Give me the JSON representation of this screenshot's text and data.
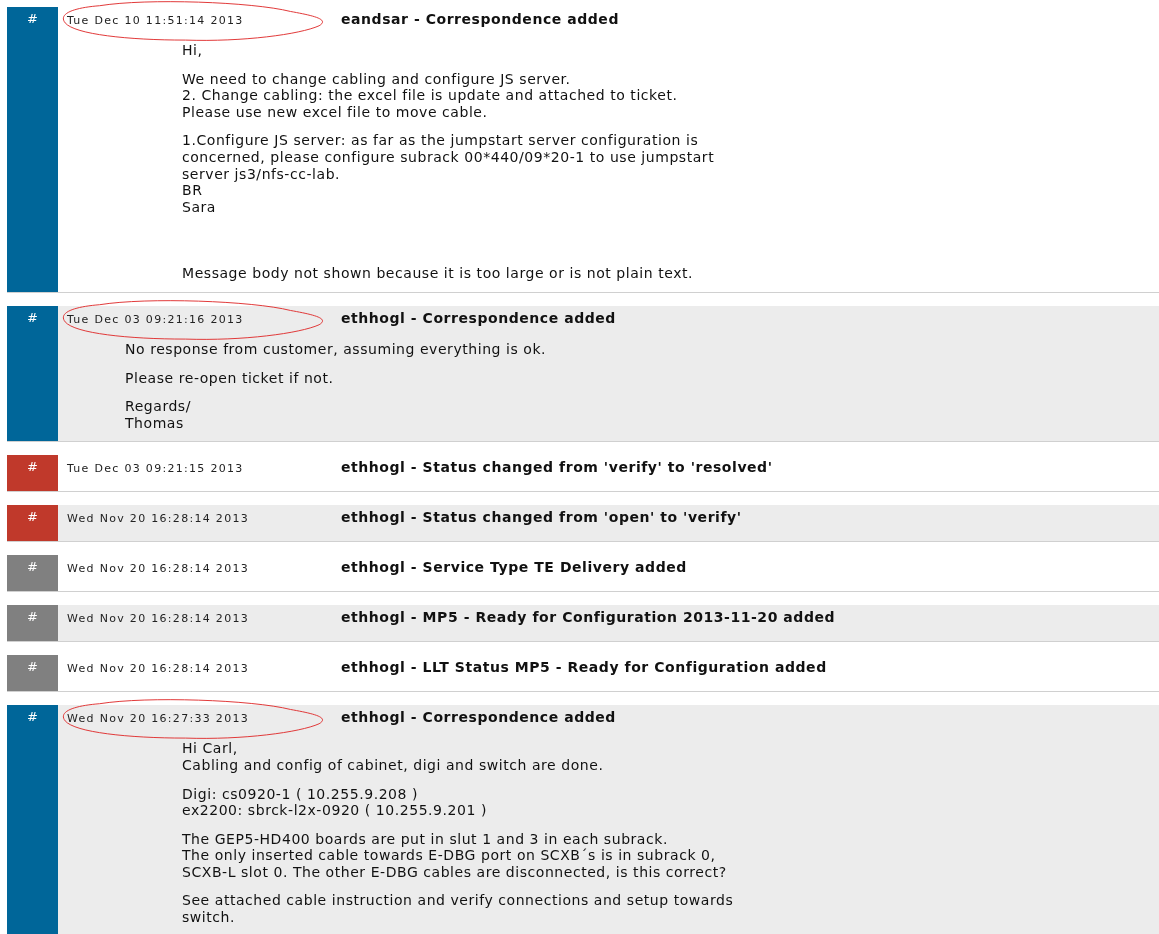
{
  "entries": [
    {
      "marker": "#",
      "kind": "correspondence",
      "shaded": false,
      "circled": true,
      "wide_indent": true,
      "date": "Tue Dec 10 11:51:14 2013",
      "title": "eandsar - Correspondence added",
      "paragraphs": [
        "Hi,",
        "We need to change cabling and configure JS server.\n2. Change cabling: the excel file is update and attached to ticket.\nPlease use new excel file to move cable.",
        "1.Configure JS server: as far as the jumpstart server configuration is\nconcerned, please configure subrack 00*440/09*20-1 to use jumpstart\nserver js3/nfs-cc-lab.\nBR\nSara"
      ],
      "note": "Message body not shown because it is too large or is not plain text."
    },
    {
      "marker": "#",
      "kind": "correspondence",
      "shaded": true,
      "circled": true,
      "wide_indent": false,
      "date": "Tue Dec 03 09:21:16 2013",
      "title": "ethhogl - Correspondence added",
      "paragraphs": [
        "No response from customer, assuming everything is ok.",
        "Please re-open ticket if not.",
        "Regards/\nThomas"
      ]
    },
    {
      "marker": "#",
      "kind": "status",
      "shaded": false,
      "circled": false,
      "date": "Tue Dec 03 09:21:15 2013",
      "title": "ethhogl - Status changed from 'verify' to 'resolved'"
    },
    {
      "marker": "#",
      "kind": "status",
      "shaded": true,
      "circled": false,
      "date": "Wed Nov 20 16:28:14 2013",
      "title": "ethhogl - Status changed from 'open' to 'verify'"
    },
    {
      "marker": "#",
      "kind": "field",
      "shaded": false,
      "circled": false,
      "date": "Wed Nov 20 16:28:14 2013",
      "title": "ethhogl - Service Type TE Delivery added"
    },
    {
      "marker": "#",
      "kind": "field",
      "shaded": true,
      "circled": false,
      "date": "Wed Nov 20 16:28:14 2013",
      "title": "ethhogl - MP5 - Ready for Configuration 2013-11-20 added"
    },
    {
      "marker": "#",
      "kind": "field",
      "shaded": false,
      "circled": false,
      "date": "Wed Nov 20 16:28:14 2013",
      "title": "ethhogl - LLT Status MP5 - Ready for Configuration added"
    },
    {
      "marker": "#",
      "kind": "correspondence",
      "shaded": true,
      "circled": true,
      "wide_indent": true,
      "date": "Wed Nov 20 16:27:33 2013",
      "title": "ethhogl - Correspondence added",
      "paragraphs": [
        "Hi Carl,\nCabling and config of cabinet, digi and switch are done.",
        "Digi: cs0920-1 ( 10.255.9.208 )\nex2200: sbrck-l2x-0920 ( 10.255.9.201 )",
        "The GEP5-HD400 boards are put in slut 1 and 3 in each subrack.\nThe only inserted cable towards E-DBG port on SCXB´s is in subrack 0,\nSCXB-L slot 0. The other E-DBG cables are disconnected, is this correct?",
        "See attached cable instruction and verify connections and setup towards\nswitch."
      ]
    }
  ]
}
